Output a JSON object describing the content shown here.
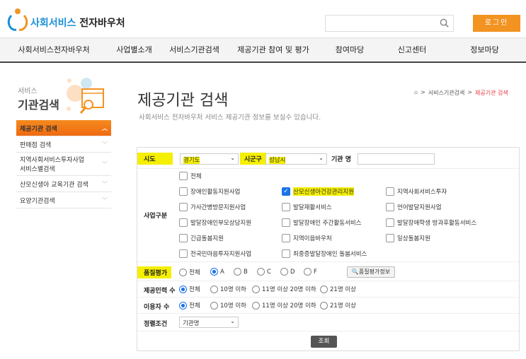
{
  "header": {
    "logo_main": "사회서비스",
    "logo_sub": "전자바우처",
    "search_placeholder": "",
    "login": "로그인"
  },
  "nav": [
    "사회서비스전자바우처",
    "사업별소개",
    "서비스기관검색",
    "제공기관 참여 및 평가",
    "참여마당",
    "신고센터",
    "정보마당"
  ],
  "sidebar": {
    "title_small": "서비스",
    "title_big": "기관검색",
    "items": [
      {
        "label": "제공기관 검색",
        "active": true
      },
      {
        "label": "판매점 검색"
      },
      {
        "label": "지역사회서비스투자사업 서비스별검색"
      },
      {
        "label": "산모신생아 교육기관 검색"
      },
      {
        "label": "요양기관검색"
      }
    ]
  },
  "page": {
    "title": "제공기관 검색",
    "subtitle": "사회서비스 전자바우처 서비스 제공기관 정보를 보실수 있습니다.",
    "breadcrumb": [
      "서비스기관검색",
      "제공기관 검색"
    ]
  },
  "form": {
    "sido_label": "시도",
    "sido_value": "경기도",
    "sigungu_label": "시군구",
    "sigungu_value": "성남시",
    "name_label": "기관 명",
    "name_value": "",
    "business_label": "사업구분",
    "business": [
      {
        "label": "전체",
        "checked": false
      },
      {
        "label": "장애인활동지원사업",
        "checked": false
      },
      {
        "label": "산모신생아건강관리지원",
        "checked": true
      },
      {
        "label": "지역사회서비스투자",
        "checked": false
      },
      {
        "label": "가사간병방문지원사업",
        "checked": false
      },
      {
        "label": "발달재활서비스",
        "checked": false
      },
      {
        "label": "언어발달지원사업",
        "checked": false
      },
      {
        "label": "발달장애인부모상담지원",
        "checked": false
      },
      {
        "label": "발달장애인 주간활동서비스",
        "checked": false
      },
      {
        "label": "발달장애학생 방과후활동서비스",
        "checked": false
      },
      {
        "label": "긴급돌봄지원",
        "checked": false
      },
      {
        "label": "지역이음바우처",
        "checked": false
      },
      {
        "label": "일상돌봄지원",
        "checked": false
      },
      {
        "label": "전국민마음투자지원사업",
        "checked": false
      },
      {
        "label": "최중증발달장애인 돌봄서비스",
        "checked": false
      }
    ],
    "quality_label": "품질평가",
    "quality": [
      "전체",
      "A",
      "B",
      "C",
      "D",
      "F"
    ],
    "quality_selected": "A",
    "quality_info": "품질평가정보",
    "staff_label": "제공인력 수",
    "staff": [
      "전체",
      "10명 이하",
      "11명 이상 20명 이하",
      "21명 이상"
    ],
    "users_label": "이용자 수",
    "users": [
      "전체",
      "10명 이하",
      "11명 이상 20명 이하",
      "21명 이상"
    ],
    "sort_label": "정렬조건",
    "sort_value": "기관명",
    "submit": "조회"
  }
}
